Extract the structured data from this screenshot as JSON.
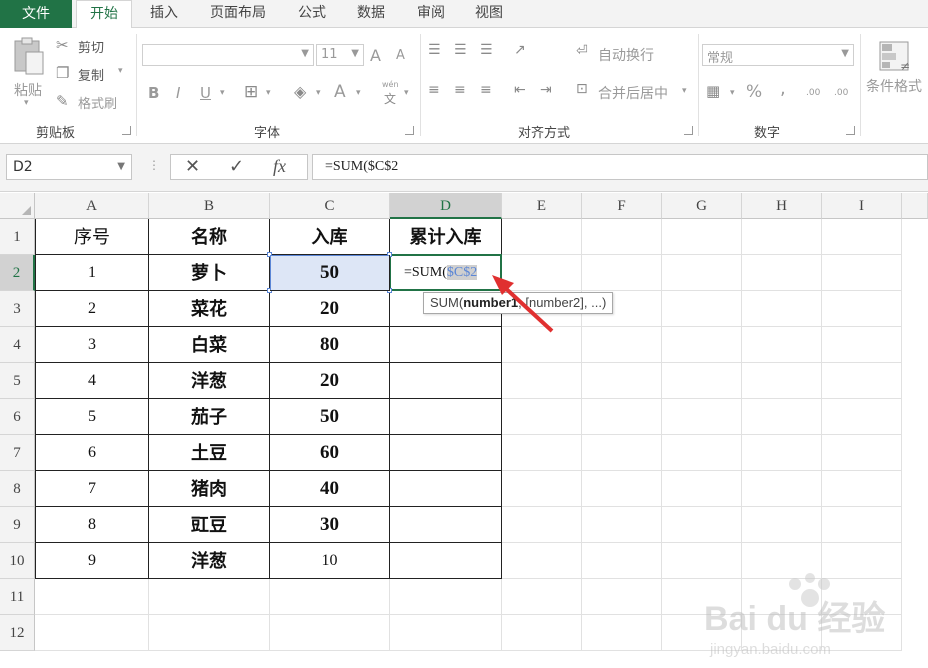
{
  "menu": {
    "file": "文件",
    "tabs": [
      "开始",
      "插入",
      "页面布局",
      "公式",
      "数据",
      "审阅",
      "视图"
    ],
    "active_tab": "开始"
  },
  "ribbon": {
    "clipboard": {
      "paste": "粘贴",
      "cut": "剪切",
      "copy": "复制",
      "format_painter": "格式刷",
      "label": "剪贴板"
    },
    "font": {
      "size": "11",
      "label": "字体",
      "bold": "B",
      "italic": "I",
      "underline": "U",
      "size_up": "A",
      "size_down": "A",
      "font_color": "A",
      "phonetic": "wén"
    },
    "alignment": {
      "wrap": "自动换行",
      "merge": "合并后居中",
      "label": "对齐方式"
    },
    "number": {
      "format": "常规",
      "percent": "%",
      "comma": ",",
      "inc_decimal": ".00",
      "dec_decimal": ".00",
      "label": "数字"
    },
    "styles": {
      "conditional": "条件格式"
    }
  },
  "formula_bar": {
    "name_box": "D2",
    "cancel": "✕",
    "enter": "✓",
    "fx": "fx",
    "formula": "=SUM($C$2"
  },
  "sheet": {
    "columns": [
      "A",
      "B",
      "C",
      "D",
      "E",
      "F",
      "G",
      "H",
      "I"
    ],
    "selected_column": "D",
    "rows": [
      "1",
      "2",
      "3",
      "4",
      "5",
      "6",
      "7",
      "8",
      "9",
      "10",
      "11",
      "12"
    ],
    "selected_row": "2",
    "headers": [
      "序号",
      "名称",
      "入库",
      "累计入库"
    ],
    "data": [
      [
        "1",
        "萝卜",
        "50"
      ],
      [
        "2",
        "菜花",
        "20"
      ],
      [
        "3",
        "白菜",
        "80"
      ],
      [
        "4",
        "洋葱",
        "20"
      ],
      [
        "5",
        "茄子",
        "50"
      ],
      [
        "6",
        "土豆",
        "60"
      ],
      [
        "7",
        "猪肉",
        "40"
      ],
      [
        "8",
        "豇豆",
        "30"
      ],
      [
        "9",
        "洋葱",
        "10"
      ]
    ],
    "d2_prefix": "=SUM(",
    "d2_ref": "$C$2"
  },
  "tooltip": {
    "func": "SUM(",
    "arg1": "number1",
    "rest": ", [number2], ...)"
  },
  "colors": {
    "accent": "#217346",
    "selection": "#5b86d6",
    "arrow": "#e03030"
  },
  "watermark": {
    "brand": "Bai du 经验",
    "url": "jingyan.baidu.com"
  }
}
